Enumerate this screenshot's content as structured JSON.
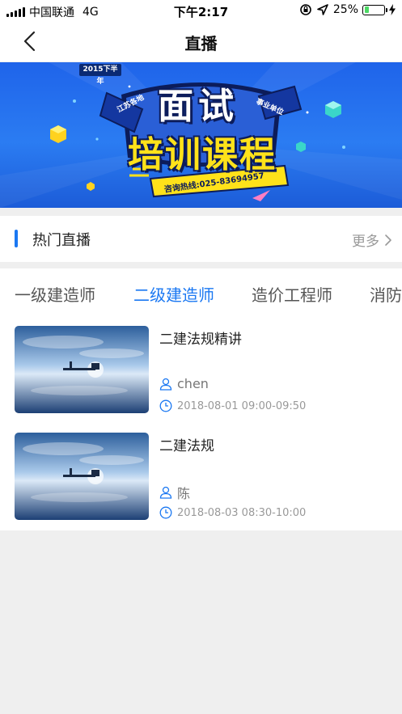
{
  "status_bar": {
    "carrier": "中国联通",
    "network": "4G",
    "time": "下午2:17",
    "battery": "25%",
    "battery_level": 0.25
  },
  "nav": {
    "back_icon": "chevron-left-icon",
    "title": "直播"
  },
  "banner": {
    "year_tag": "2015下半年",
    "line1": "面试",
    "line2": "培训课程",
    "flag_left": "江苏各地",
    "flag_right": "事业单位",
    "hotline": "咨询热线:025-83694957"
  },
  "hot_section": {
    "title": "热门直播",
    "more": "更多"
  },
  "tabs": [
    {
      "label": "一级建造师",
      "active": false
    },
    {
      "label": "二级建造师",
      "active": true
    },
    {
      "label": "造价工程师",
      "active": false
    },
    {
      "label": "消防",
      "active": false
    }
  ],
  "lives": [
    {
      "title": "二建法规精讲",
      "teacher": "chen",
      "time": "2018-08-01 09:00-09:50"
    },
    {
      "title": "二建法规",
      "teacher": "陈",
      "time": "2018-08-03 08:30-10:00"
    }
  ],
  "colors": {
    "accent": "#1b78f2",
    "banner_blue": "#2b7cf2",
    "banner_yellow": "#ffe21a",
    "background": "#efefef"
  }
}
